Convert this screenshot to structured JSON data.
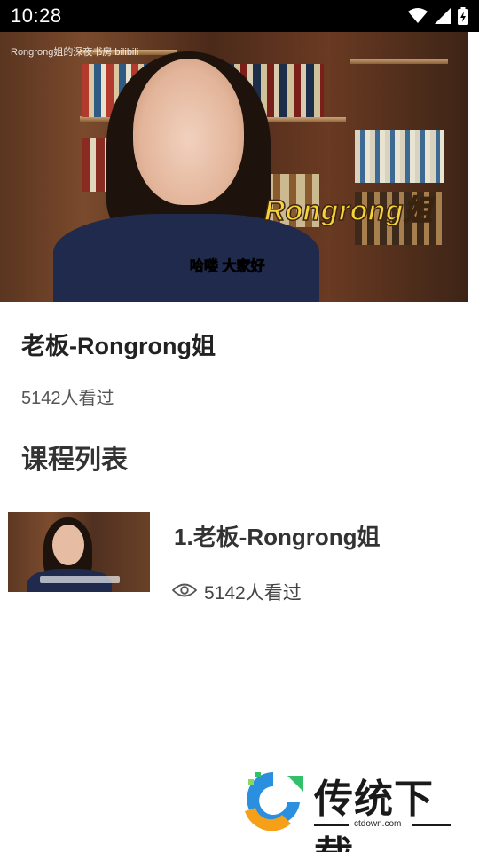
{
  "status_bar": {
    "time": "10:28"
  },
  "video": {
    "watermark": "Rongrong姐的深夜书房 bilibili",
    "caption": "Rongrong姐",
    "subtitle": "哈喽 大家好"
  },
  "course": {
    "title": "老板-Rongrong姐",
    "views": "5142人看过"
  },
  "section": {
    "title": "课程列表"
  },
  "lessons": [
    {
      "title": "1.老板-Rongrong姐",
      "views": "5142人看过",
      "icon": "eye-icon"
    }
  ],
  "site_logo": {
    "name": "传统下载",
    "domain": "ctdown.com"
  },
  "colors": {
    "accent": "#f6d23b",
    "text": "#222222",
    "muted": "#555555"
  }
}
